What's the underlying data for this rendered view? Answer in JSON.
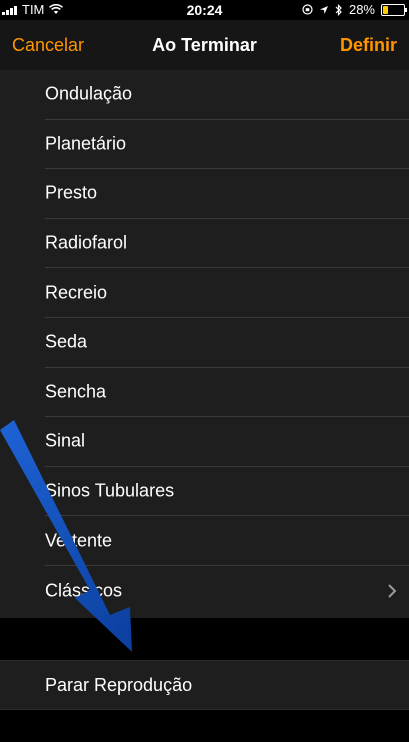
{
  "status": {
    "carrier": "TIM",
    "time": "20:24",
    "battery": "28%",
    "battery_level": 0.28
  },
  "nav": {
    "cancel": "Cancelar",
    "title": "Ao Terminar",
    "done": "Definir"
  },
  "tones": [
    {
      "label": "Ondulação"
    },
    {
      "label": "Planetário"
    },
    {
      "label": "Presto"
    },
    {
      "label": "Radiofarol"
    },
    {
      "label": "Recreio"
    },
    {
      "label": "Seda"
    },
    {
      "label": "Sencha"
    },
    {
      "label": "Sinal"
    },
    {
      "label": "Sinos Tubulares"
    },
    {
      "label": "Vertente"
    },
    {
      "label": "Clássicos"
    }
  ],
  "stop": {
    "label": "Parar Reprodução"
  },
  "colors": {
    "accent": "#ff9500",
    "annotation_arrow": "#1e63d6"
  },
  "icons": [
    "wifi-icon",
    "orientation-lock-icon",
    "location-icon",
    "bluetooth-icon",
    "chevron-right-icon",
    "annotation-arrow"
  ]
}
